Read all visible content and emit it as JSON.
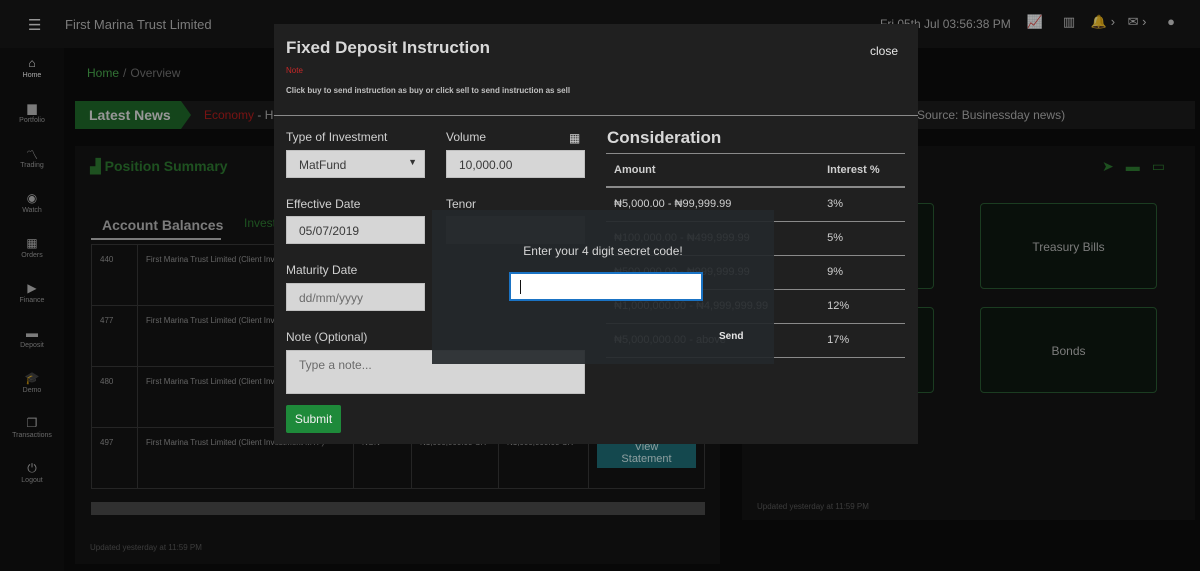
{
  "app": {
    "title": "First Marina Trust Limited",
    "clock": "Fri 05th Jul 03:56:38 PM",
    "menu_icon": "☰"
  },
  "top_icons": [
    {
      "name": "line-chart-icon",
      "glyph": "📈"
    },
    {
      "name": "bar-chart-icon",
      "glyph": "▥"
    },
    {
      "name": "bell-icon",
      "glyph": "🔔 ›"
    },
    {
      "name": "mail-icon",
      "glyph": "✉ ›"
    },
    {
      "name": "user-icon",
      "glyph": "●"
    }
  ],
  "sidebar": {
    "items": [
      {
        "label": "Home",
        "icon": "⌂"
      },
      {
        "label": "Portfolio",
        "icon": "▆"
      },
      {
        "label": "Trading",
        "icon": "〽"
      },
      {
        "label": "Watch",
        "icon": "◉"
      },
      {
        "label": "Orders",
        "icon": "▦"
      },
      {
        "label": "Finance",
        "icon": "▶"
      },
      {
        "label": "Deposit",
        "icon": "▬"
      },
      {
        "label": "Demo",
        "icon": "🎓"
      },
      {
        "label": "Transactions",
        "icon": "❐"
      },
      {
        "label": "Logout",
        "icon": "⏻"
      }
    ]
  },
  "breadcrumb": {
    "home": "Home",
    "sep": "/",
    "current": "Overview"
  },
  "news": {
    "label": "Latest News",
    "category": "Economy",
    "headline": "- Ho",
    "source": "Source: Businessday news)"
  },
  "position_summary": {
    "title": "Position Summary",
    "tab_active": "Account Balances",
    "tab_2": "Invest",
    "rows": [
      {
        "id": "440",
        "name": "First Marina Trust Limited (Client Investment MTF)"
      },
      {
        "id": "477",
        "name": "First Marina Trust Limited (Client Investment MTF)"
      },
      {
        "id": "480",
        "name": "First Marina Trust Limited (Client Investment MTF)"
      },
      {
        "id": "497",
        "name": "First Marina Trust Limited (Client Investment MTF)",
        "currency": "NGN",
        "bal1": "₦1,000,000.00 CR",
        "bal2": "₦1,000,000.00 CR",
        "action": "View Statement"
      }
    ],
    "updated": "Updated yesterday at 11:59 PM"
  },
  "products": {
    "icons": [
      "paper-plane-icon",
      "wallet-icon",
      "credit-card-icon"
    ],
    "items": [
      "",
      "Treasury Bills",
      "",
      "Bonds"
    ],
    "updated": "Updated yesterday at 11:59 PM"
  },
  "modal": {
    "title": "Fixed Deposit Instruction",
    "close": "close",
    "note": "Note",
    "instruction": "Click buy to send instruction as buy or click sell to send instruction as sell",
    "type_label": "Type of Investment",
    "type_value": "MatFund",
    "volume_label": "Volume",
    "volume_value": "10,000.00",
    "effective_label": "Effective Date",
    "effective_value": "05/07/2019",
    "tenor_label": "Tenor",
    "maturity_label": "Maturity Date",
    "maturity_placeholder": "dd/mm/yyyy",
    "note_label": "Note (Optional)",
    "note_placeholder": "Type a note...",
    "submit": "Submit",
    "consideration": {
      "title": "Consideration",
      "headers": [
        "Amount",
        "Interest %"
      ],
      "rows": [
        {
          "amount": "₦5,000.00 - ₦99,999.99",
          "rate": "3%"
        },
        {
          "amount": "₦100,000.00 - ₦499,999.99",
          "rate": "5%"
        },
        {
          "amount": "₦500,000.00 - ₦999,999.99",
          "rate": "9%"
        },
        {
          "amount": "₦1,000,000.00 - ₦4,999,999.99",
          "rate": "12%"
        },
        {
          "amount": "₦5,000,000.00 - above",
          "rate": "17%"
        }
      ]
    }
  },
  "secret_code": {
    "prompt": "Enter your 4 digit secret code!",
    "value": "",
    "send": "Send"
  }
}
